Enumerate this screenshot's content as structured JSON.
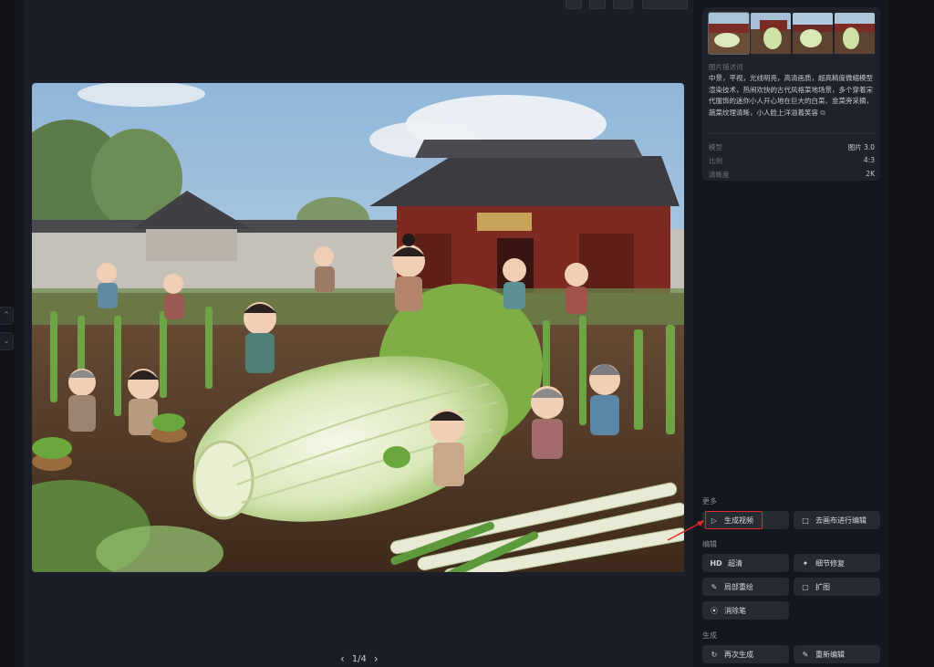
{
  "pager": {
    "current": "1/4",
    "prev_icon": "chevron-left-icon",
    "next_icon": "chevron-right-icon"
  },
  "info": {
    "prompt_label": "图片描述词",
    "prompt_text": "中景，平视，光线明亮，高清画质，超高精度微缩模型渲染技术，热闹欢快的古代风格菜地场景，多个穿着宋代服饰的迷你小人开心地在巨大的白菜、韭菜旁采摘，蔬菜纹理清晰，小人脸上洋溢着笑容",
    "copy_icon": "copy-icon",
    "meta": [
      {
        "key": "模型",
        "value": "图片 3.0"
      },
      {
        "key": "比例",
        "value": "4:3"
      },
      {
        "key": "清晰度",
        "value": "2K"
      }
    ]
  },
  "sections": {
    "more": "更多",
    "edit": "编辑",
    "generate": "生成"
  },
  "buttons": {
    "gen_video": "生成视频",
    "canvas_edit": "去画布进行编辑",
    "hd": "超清",
    "hd_prefix": "HD",
    "detail_fix": "细节修复",
    "local_redraw": "局部重绘",
    "expand": "扩图",
    "eraser": "消除笔",
    "regenerate": "再次生成",
    "re_edit": "重新编辑"
  },
  "colors": {
    "highlight": "#e02b2b",
    "panel": "#1f222b",
    "button": "#262a33"
  }
}
